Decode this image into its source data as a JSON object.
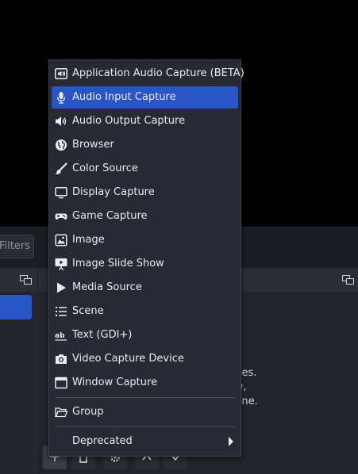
{
  "filters_button": {
    "label": "Filters"
  },
  "sources_hint": {
    "line1": "urces.",
    "line2": "low,",
    "line3": "d one."
  },
  "toolbar": {
    "add": "+",
    "remove": "trash-icon",
    "settings": "gear-icon",
    "move_up": "chevron-up-icon",
    "move_down": "chevron-down-icon"
  },
  "menu": {
    "items": [
      {
        "label": "Application Audio Capture (BETA)",
        "icon": "app-audio-icon"
      },
      {
        "label": "Audio Input Capture",
        "icon": "microphone-icon",
        "selected": true
      },
      {
        "label": "Audio Output Capture",
        "icon": "speaker-icon"
      },
      {
        "label": "Browser",
        "icon": "globe-icon"
      },
      {
        "label": "Color Source",
        "icon": "paint-brush-icon"
      },
      {
        "label": "Display Capture",
        "icon": "monitor-icon"
      },
      {
        "label": "Game Capture",
        "icon": "gamepad-icon"
      },
      {
        "label": "Image",
        "icon": "image-icon"
      },
      {
        "label": "Image Slide Show",
        "icon": "slideshow-icon"
      },
      {
        "label": "Media Source",
        "icon": "play-icon"
      },
      {
        "label": "Scene",
        "icon": "list-icon"
      },
      {
        "label": "Text (GDI+)",
        "icon": "text-icon"
      },
      {
        "label": "Video Capture Device",
        "icon": "camera-icon"
      },
      {
        "label": "Window Capture",
        "icon": "window-icon"
      }
    ],
    "group": {
      "label": "Group",
      "icon": "folder-icon"
    },
    "deprecated": {
      "label": "Deprecated"
    }
  },
  "colors": {
    "menu_bg": "#272a33",
    "selected": "#2a55c6",
    "panel_bg": "#23252b"
  }
}
